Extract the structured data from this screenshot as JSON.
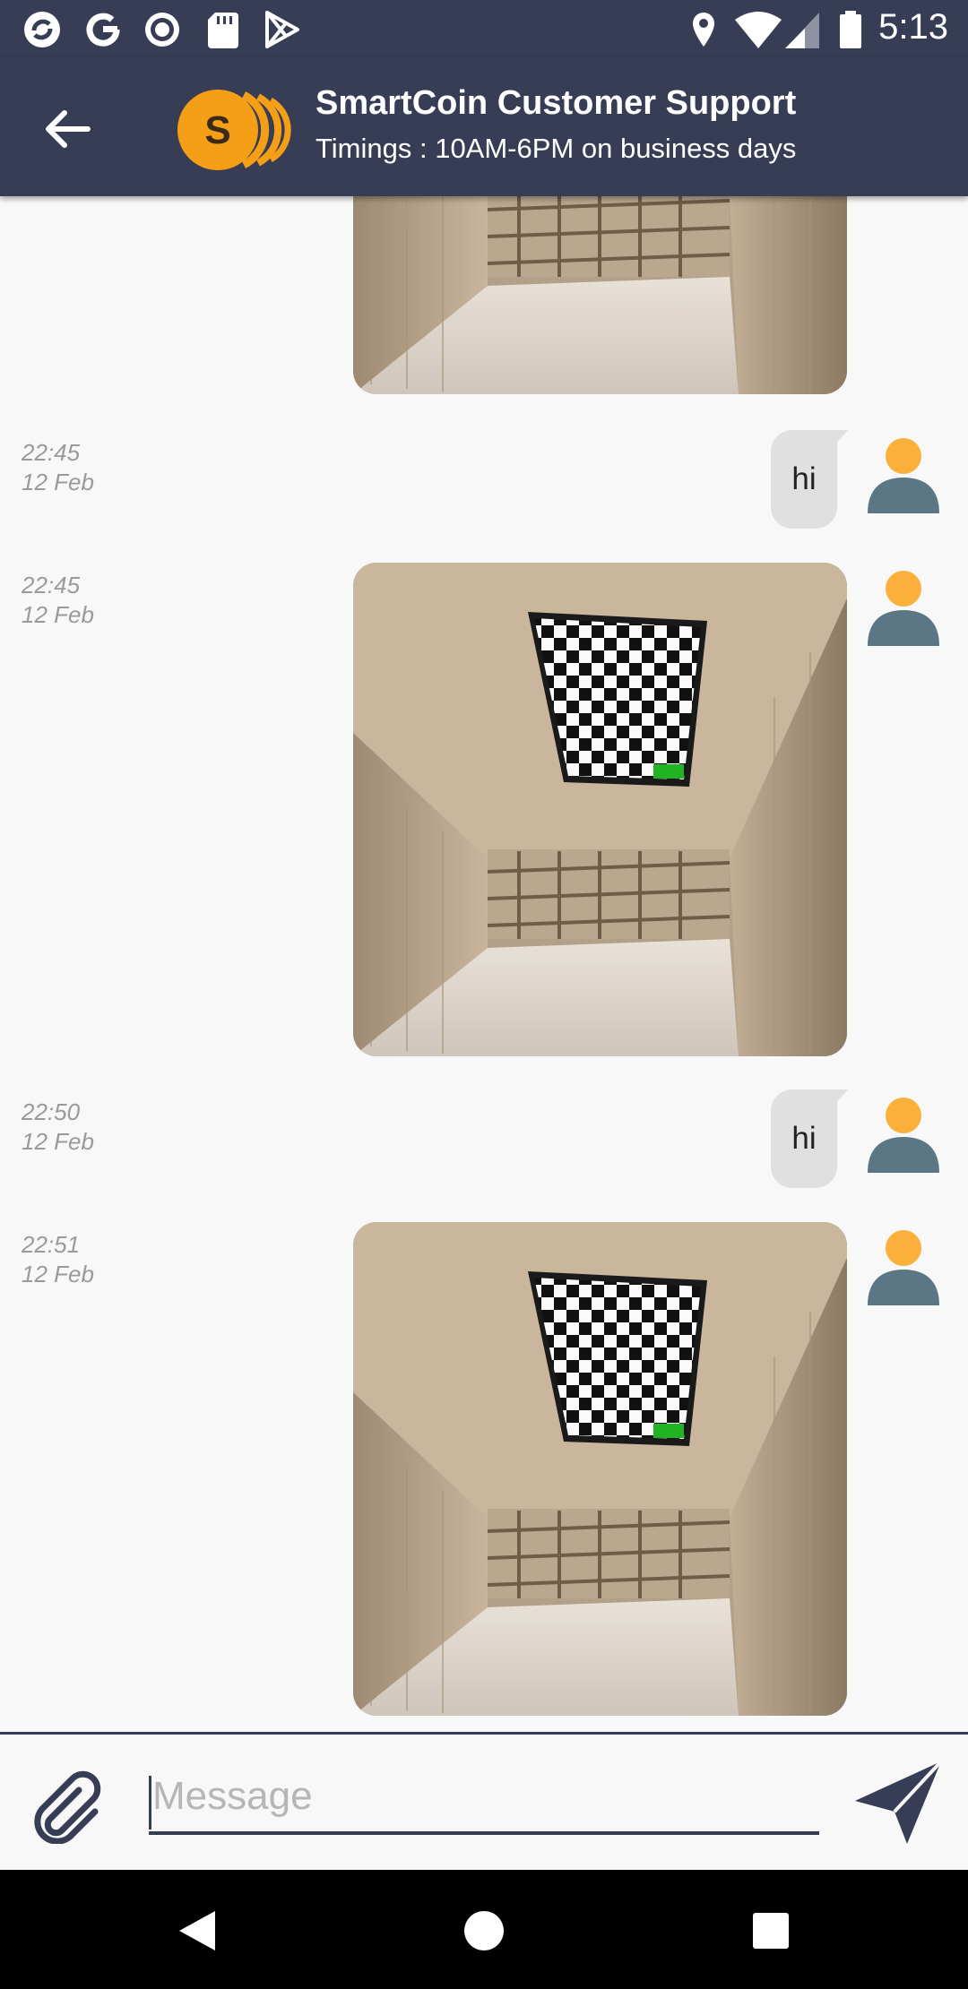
{
  "status_bar": {
    "time": "5:13",
    "left_icons": [
      "sync-icon",
      "google-icon",
      "record-icon",
      "sd-card-icon",
      "play-store-icon"
    ],
    "right_icons": [
      "location-icon",
      "wifi-icon",
      "signal-icon",
      "battery-icon"
    ]
  },
  "header": {
    "title": "SmartCoin Customer Support",
    "subtitle": "Timings : 10AM-6PM on business days",
    "logo_letter": "S",
    "back_icon": "arrow-left-icon"
  },
  "messages": [
    {
      "type": "image",
      "image": "room-ceiling-photo",
      "partial": true
    },
    {
      "type": "text",
      "time": "22:45",
      "date": "12 Feb",
      "text": "hi"
    },
    {
      "type": "image",
      "time": "22:45",
      "date": "12 Feb",
      "image": "room-ceiling-photo"
    },
    {
      "type": "text",
      "time": "22:50",
      "date": "12 Feb",
      "text": "hi"
    },
    {
      "type": "image",
      "time": "22:51",
      "date": "12 Feb",
      "image": "room-ceiling-photo"
    }
  ],
  "composer": {
    "placeholder": "Message",
    "value": "",
    "attach_icon": "paperclip-icon",
    "send_icon": "send-icon"
  },
  "colors": {
    "header_bg": "#363d54",
    "logo_orange": "#f59f17",
    "avatar_head": "#fbb03b",
    "avatar_body": "#5b7786",
    "bubble_bg": "#e0e0e0",
    "time_text": "#9a9a9a"
  }
}
